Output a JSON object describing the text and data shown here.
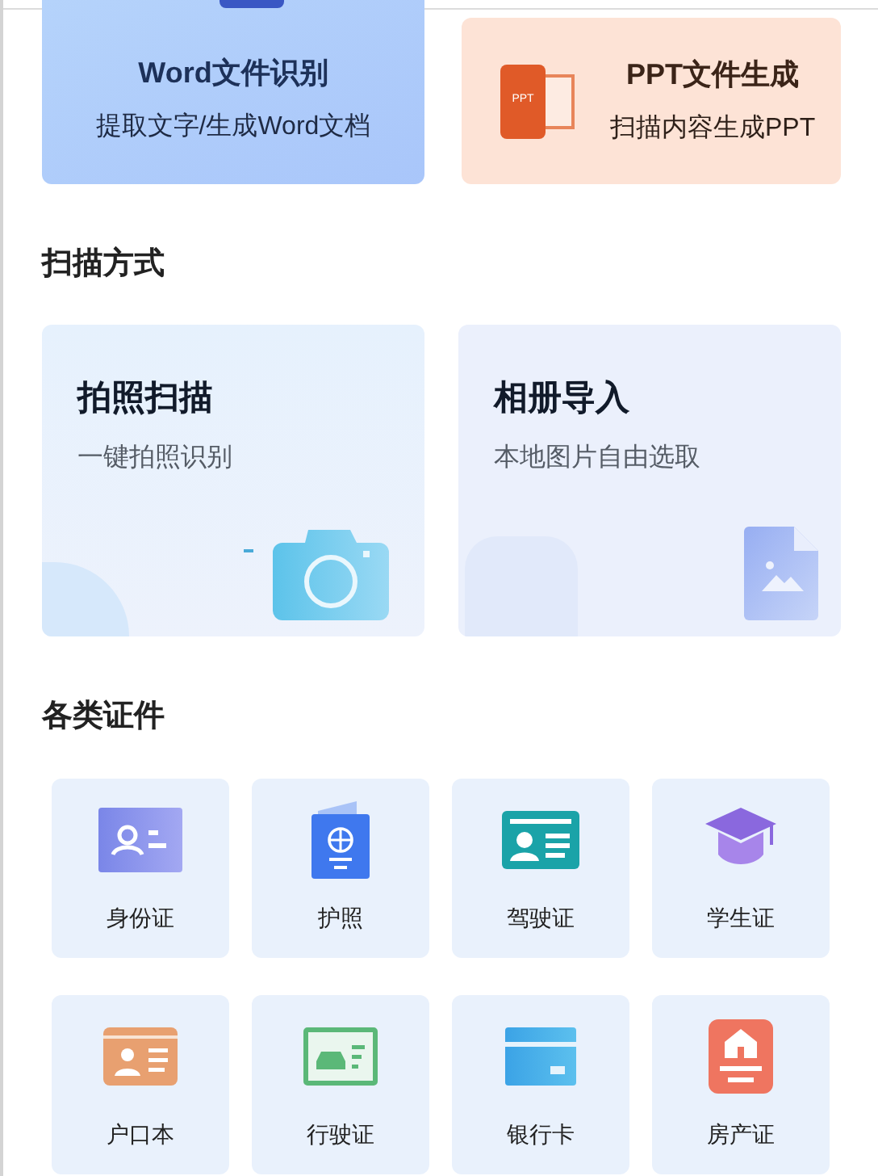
{
  "feature_cards": [
    {
      "kind": "word",
      "title": "Word文件识别",
      "subtitle": "提取文字/生成Word文档"
    },
    {
      "kind": "ppt",
      "title": "PPT文件生成",
      "subtitle": "扫描内容生成PPT",
      "icon_text": "PPT"
    }
  ],
  "scan_section": {
    "title": "扫描方式",
    "cards": [
      {
        "kind": "camera",
        "title": "拍照扫描",
        "subtitle": "一键拍照识别"
      },
      {
        "kind": "album",
        "title": "相册导入",
        "subtitle": "本地图片自由选取"
      }
    ]
  },
  "id_section": {
    "title": "各类证件",
    "items": [
      {
        "kind": "id",
        "label": "身份证"
      },
      {
        "kind": "passport",
        "label": "护照"
      },
      {
        "kind": "driver",
        "label": "驾驶证"
      },
      {
        "kind": "student",
        "label": "学生证"
      },
      {
        "kind": "household",
        "label": "户口本"
      },
      {
        "kind": "vehicle",
        "label": "行驶证"
      },
      {
        "kind": "bank",
        "label": "银行卡"
      },
      {
        "kind": "property",
        "label": "房产证"
      }
    ]
  }
}
